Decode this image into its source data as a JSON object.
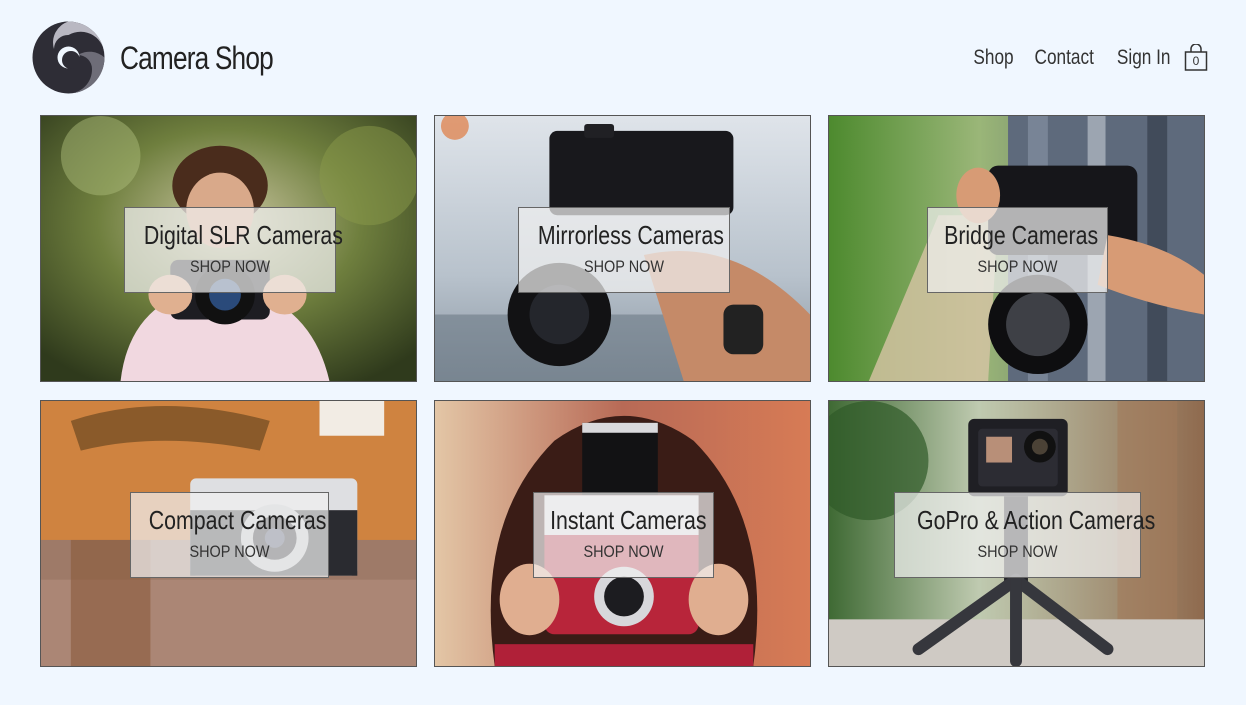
{
  "header": {
    "brand": "Camera Shop",
    "nav": {
      "shop": "Shop",
      "contact": "Contact",
      "sign_in": "Sign In"
    },
    "cart_count": "0"
  },
  "categories": [
    {
      "title": "Digital SLR Cameras",
      "cta": "SHOP NOW"
    },
    {
      "title": "Mirrorless Cameras",
      "cta": "SHOP NOW"
    },
    {
      "title": "Bridge Cameras",
      "cta": "SHOP NOW"
    },
    {
      "title": "Compact Cameras",
      "cta": "SHOP NOW"
    },
    {
      "title": "Instant Cameras",
      "cta": "SHOP NOW"
    },
    {
      "title": "GoPro & Action Cameras",
      "cta": "SHOP NOW"
    }
  ],
  "colors": {
    "page_background": "#f0f7ff",
    "text": "#222222",
    "overlay": "rgba(240,240,240,0.72)"
  },
  "icons": [
    "camera-shop-logo-icon",
    "shopping-bag-icon"
  ]
}
